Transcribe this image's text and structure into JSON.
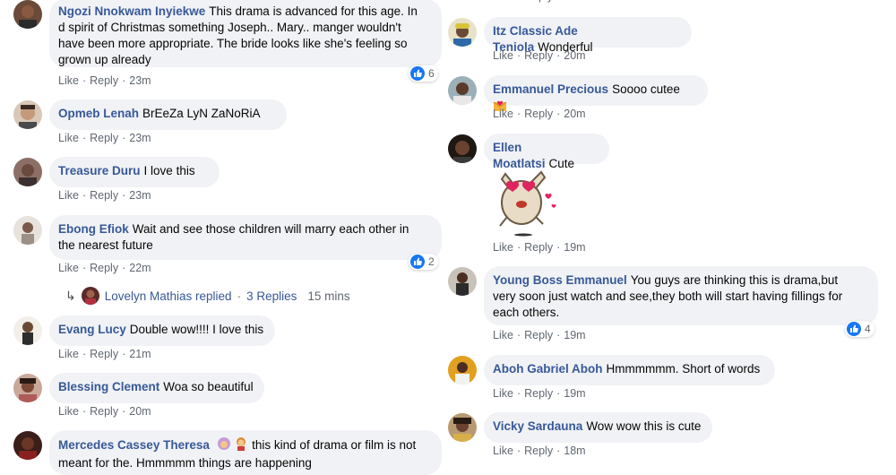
{
  "colors": {
    "author": "#385898",
    "meta": "#606770",
    "bubble": "#f0f2f5",
    "like_blue": "#1877f2"
  },
  "actions": {
    "like": "Like",
    "reply": "Reply",
    "sep": "·"
  },
  "left_comments": [
    {
      "author": "Ngozi Nnokwam Inyiekwe",
      "text_lines": [
        "This drama is advanced for this age. In",
        "d spirit of Christmas something Joseph.. Mary.. manger wouldn't",
        "have been more appropriate. The bride looks like she's feeling so",
        "grown up already"
      ],
      "time": "23m",
      "reactions": "6"
    },
    {
      "author": "Opmeb Lenah",
      "text": "BrEeZa LyN ZaNoRiA",
      "time": "23m"
    },
    {
      "author": "Treasure Duru",
      "text": "I love this",
      "time": "23m"
    },
    {
      "author": "Ebong Efiok",
      "text_lines": [
        "Wait and see those children will marry each other in",
        "the nearest future"
      ],
      "time": "22m",
      "reactions": "2"
    },
    {
      "author": "Evang Lucy",
      "text": "Double wow!!!! I love this",
      "time": "21m"
    },
    {
      "author": "Blessing Clement",
      "text": "Woa so beautiful",
      "time": "20m"
    },
    {
      "author": "Mercedes Cassey Theresa",
      "text_lines": [
        "this kind of drama or film is not",
        "meant for the. Hmmmmm things are happening"
      ]
    }
  ],
  "replies_row": {
    "name": "Lovelyn Mathias replied",
    "sep": "·",
    "count": "3 Replies",
    "time": "15 mins"
  },
  "right_comments": [
    {
      "author": "Itz Classic Ade Teniola",
      "text": "Wonderful",
      "time": "20m"
    },
    {
      "author": "Emmanuel Precious",
      "text": "Soooo cutee",
      "time": "20m"
    },
    {
      "author": "Ellen Moatlatsi",
      "text": "Cute",
      "time": "19m"
    },
    {
      "author": "Young Boss Emmanuel",
      "text_lines": [
        "You guys are thinking this is drama,but",
        "very soon just watch and see,they both will start having fillings for",
        "each others."
      ],
      "time": "19m",
      "reactions": "4"
    },
    {
      "author": "Aboh Gabriel Aboh",
      "text": "Hmmmmmm. Short of words",
      "time": "19m"
    },
    {
      "author": "Vicky Sardauna",
      "text": "Wow wow this is cute",
      "time": "18m"
    }
  ],
  "icons": {
    "like": "thumbs-up-icon",
    "reply_arrow": "reply-arrow-icon",
    "sticker": "heart-eyes-bunny-sticker"
  }
}
